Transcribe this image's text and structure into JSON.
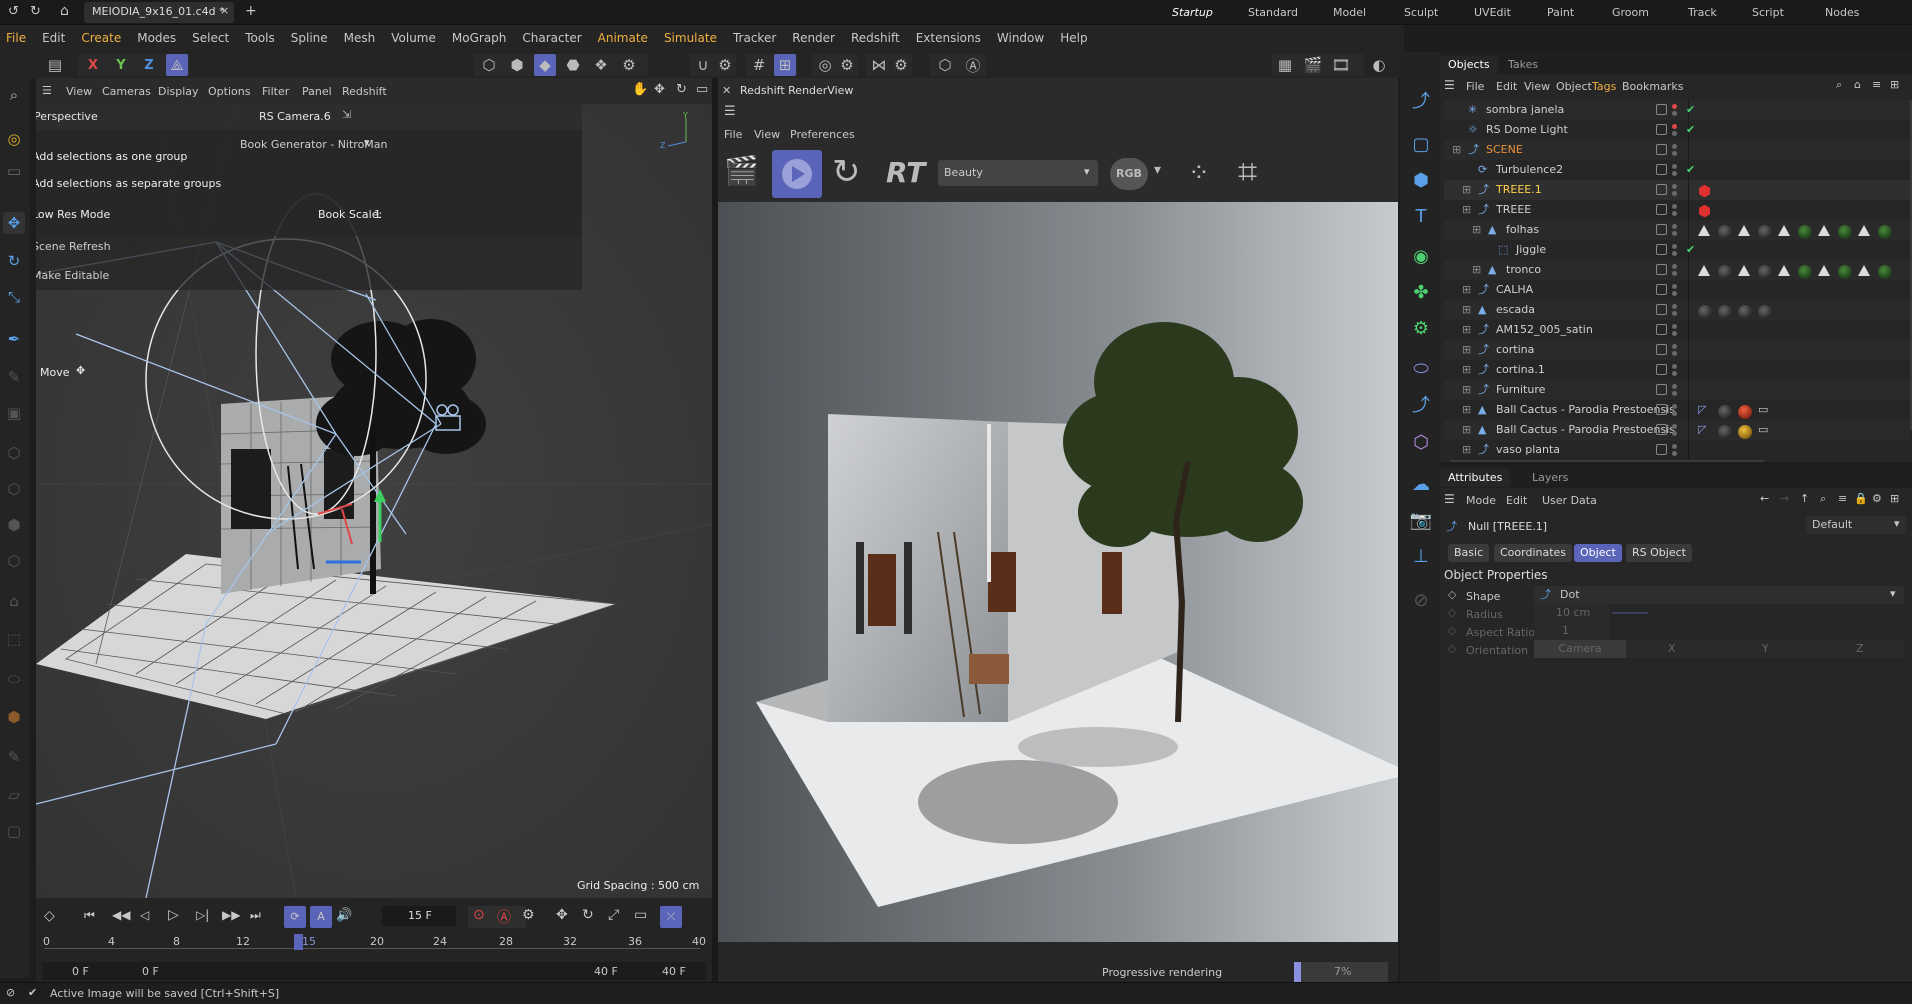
{
  "window": {
    "title": "MEIODIA_9x16_01.c4d *",
    "plus": "+"
  },
  "layouts": [
    "Startup",
    "Standard",
    "Model",
    "Sculpt",
    "UVEdit",
    "Paint",
    "Groom",
    "Track",
    "Script",
    "Nodes"
  ],
  "menu": [
    "File",
    "Edit",
    "Create",
    "Modes",
    "Select",
    "Tools",
    "Spline",
    "Mesh",
    "Volume",
    "MoGraph",
    "Character",
    "Animate",
    "Simulate",
    "Tracker",
    "Render",
    "Redshift",
    "Extensions",
    "Window",
    "Help"
  ],
  "axis": {
    "x": "X",
    "y": "Y",
    "z": "Z"
  },
  "viewport": {
    "menu": [
      "View",
      "Cameras",
      "Display",
      "Options",
      "Filter",
      "Panel",
      "Redshift"
    ],
    "mode": "Perspective",
    "camera": "RS Camera.6",
    "grid": "Grid Spacing : 500 cm"
  },
  "book_gen": {
    "title": "Book Generator - NitroMan",
    "opt1": "Add selections as one group",
    "opt2": "Add selections as separate groups",
    "lowres": "Low Res Mode",
    "scale_label": "Book Scale:",
    "scale_val": "1",
    "refresh": "Scene Refresh",
    "editable": "Make Editable",
    "move": "Move"
  },
  "timeline": {
    "frame": "15 F",
    "ticks": [
      "0",
      "4",
      "8",
      "12",
      "20",
      "24",
      "28",
      "32",
      "36",
      "40"
    ],
    "cur": "15",
    "start": "0 F",
    "min": "0 F",
    "max": "40 F",
    "end": "40 F"
  },
  "renderview": {
    "title": "Redshift RenderView",
    "menu": [
      "File",
      "View",
      "Preferences"
    ],
    "rt": "RT",
    "aov": "Beauty",
    "rgb": "RGB",
    "status": "Progressive rendering",
    "progress": "7%",
    "progress_value": 0.07
  },
  "objects": {
    "tabs": [
      "Objects",
      "Takes"
    ],
    "menu": [
      "File",
      "Edit",
      "View",
      "Object",
      "Tags",
      "Bookmarks"
    ],
    "rows": [
      {
        "name": "sombra janela",
        "indent": 0
      },
      {
        "name": "RS Dome Light",
        "indent": 0
      },
      {
        "name": "SCENE",
        "indent": 0,
        "color": "#e8913a"
      },
      {
        "name": "Turbulence2",
        "indent": 1
      },
      {
        "name": "TREEE.1",
        "indent": 1,
        "color": "#ffd24a"
      },
      {
        "name": "TREEE",
        "indent": 1
      },
      {
        "name": "folhas",
        "indent": 2
      },
      {
        "name": "Jiggle",
        "indent": 3
      },
      {
        "name": "tronco",
        "indent": 2
      },
      {
        "name": "CALHA",
        "indent": 1
      },
      {
        "name": "escada",
        "indent": 1
      },
      {
        "name": "AM152_005_satin",
        "indent": 1
      },
      {
        "name": "cortina",
        "indent": 1
      },
      {
        "name": "cortina.1",
        "indent": 1
      },
      {
        "name": "Furniture",
        "indent": 1
      },
      {
        "name": "Ball Cactus - Parodia Prestoensis",
        "indent": 1
      },
      {
        "name": "Ball Cactus - Parodia Prestoensis",
        "indent": 1
      },
      {
        "name": "vaso planta",
        "indent": 1
      }
    ]
  },
  "attributes": {
    "tabs": [
      "Attributes",
      "Layers"
    ],
    "menu": [
      "Mode",
      "Edit",
      "User Data"
    ],
    "object": "Null [TREEE.1]",
    "preset": "Default",
    "subtabs": [
      "Basic",
      "Coordinates",
      "Object",
      "RS Object"
    ],
    "section": "Object Properties",
    "shape_label": "Shape",
    "shape_val": "Dot",
    "radius_label": "Radius",
    "radius_val": "10 cm",
    "aspect_label": "Aspect Ratio",
    "aspect_val": "1",
    "orient_label": "Orientation",
    "orient_val": "Camera",
    "x": "X",
    "y": "Y",
    "z": "Z"
  },
  "status": "Active Image will be saved [Ctrl+Shift+S]"
}
